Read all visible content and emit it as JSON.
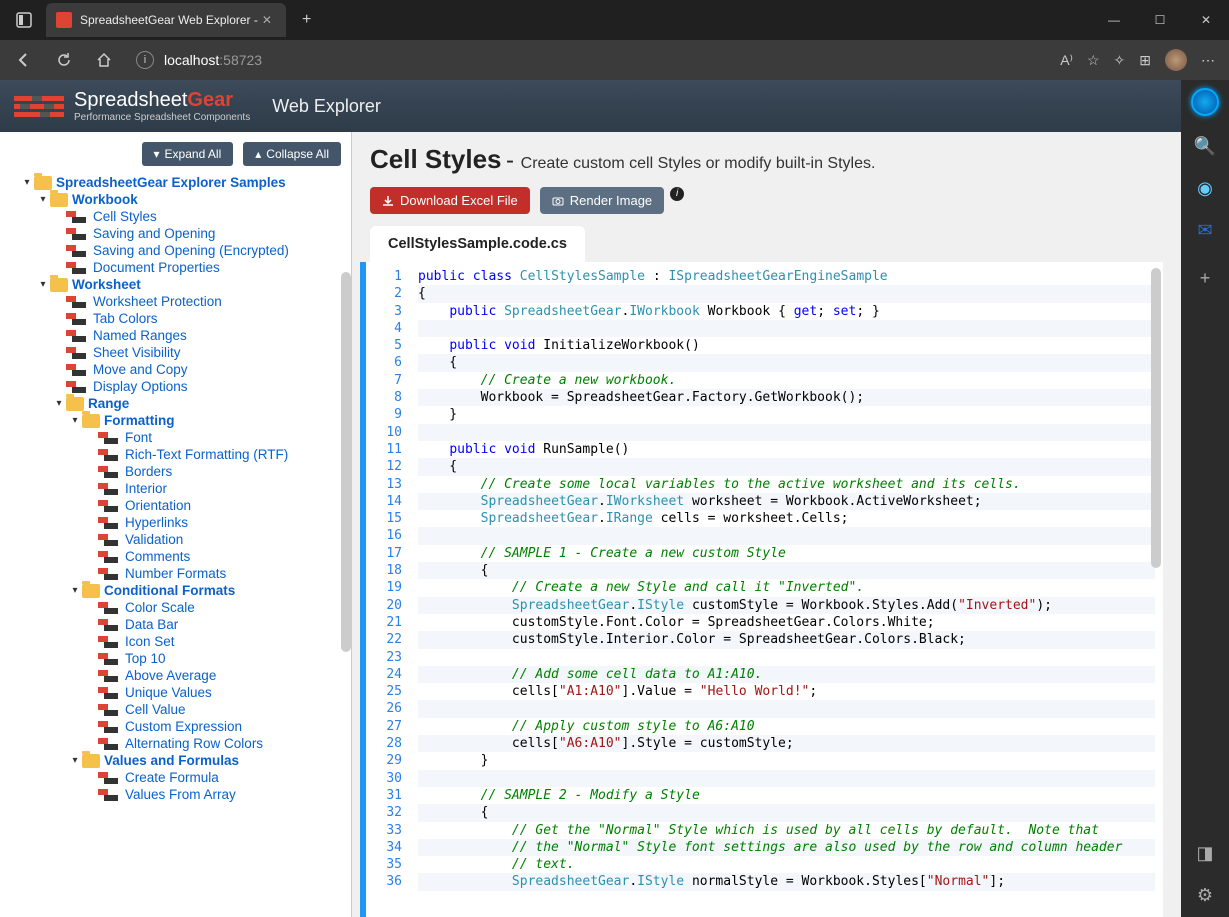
{
  "browser": {
    "tab_title": "SpreadsheetGear Web Explorer - ",
    "url_host": "localhost",
    "url_port": ":58723"
  },
  "app": {
    "brand_name_pre": "Spreadsheet",
    "brand_name_post": "Gear",
    "brand_tagline": "Performance Spreadsheet Components",
    "page_title": "Web Explorer"
  },
  "tree": {
    "expand_all": "Expand All",
    "collapse_all": "Collapse All",
    "root": "SpreadsheetGear Explorer Samples",
    "workbook": "Workbook",
    "workbook_items": [
      "Cell Styles",
      "Saving and Opening",
      "Saving and Opening (Encrypted)",
      "Document Properties"
    ],
    "worksheet": "Worksheet",
    "worksheet_items": [
      "Worksheet Protection",
      "Tab Colors",
      "Named Ranges",
      "Sheet Visibility",
      "Move and Copy",
      "Display Options"
    ],
    "range": "Range",
    "formatting": "Formatting",
    "formatting_items": [
      "Font",
      "Rich-Text Formatting (RTF)",
      "Borders",
      "Interior",
      "Orientation",
      "Hyperlinks",
      "Validation",
      "Comments",
      "Number Formats"
    ],
    "conditional": "Conditional Formats",
    "conditional_items": [
      "Color Scale",
      "Data Bar",
      "Icon Set",
      "Top 10",
      "Above Average",
      "Unique Values",
      "Cell Value",
      "Custom Expression",
      "Alternating Row Colors"
    ],
    "values": "Values and Formulas",
    "values_items": [
      "Create Formula",
      "Values From Array"
    ]
  },
  "main": {
    "title": "Cell Styles",
    "subtitle": "Create custom cell Styles or modify built-in Styles.",
    "download": "Download Excel File",
    "render": "Render Image",
    "tab": "CellStylesSample.code.cs"
  },
  "code": {
    "lines": [
      {
        "n": 1,
        "html": "<span class='kw'>public</span> <span class='kw'>class</span> <span class='tp'>CellStylesSample</span> : <span class='tp'>ISpreadsheetGearEngineSample</span>"
      },
      {
        "n": 2,
        "html": "{"
      },
      {
        "n": 3,
        "html": "    <span class='kw'>public</span> <span class='tp'>SpreadsheetGear</span>.<span class='tp'>IWorkbook</span> Workbook { <span class='kw'>get</span>; <span class='kw'>set</span>; }"
      },
      {
        "n": 4,
        "html": ""
      },
      {
        "n": 5,
        "html": "    <span class='kw'>public</span> <span class='kw'>void</span> InitializeWorkbook()"
      },
      {
        "n": 6,
        "html": "    {"
      },
      {
        "n": 7,
        "html": "        <span class='cm'>// Create a new workbook.</span>"
      },
      {
        "n": 8,
        "html": "        Workbook = SpreadsheetGear.Factory.GetWorkbook();"
      },
      {
        "n": 9,
        "html": "    }"
      },
      {
        "n": 10,
        "html": ""
      },
      {
        "n": 11,
        "html": "    <span class='kw'>public</span> <span class='kw'>void</span> RunSample()"
      },
      {
        "n": 12,
        "html": "    {"
      },
      {
        "n": 13,
        "html": "        <span class='cm'>// Create some local variables to the active worksheet and its cells.</span>"
      },
      {
        "n": 14,
        "html": "        <span class='tp'>SpreadsheetGear</span>.<span class='tp'>IWorksheet</span> worksheet = Workbook.ActiveWorksheet;"
      },
      {
        "n": 15,
        "html": "        <span class='tp'>SpreadsheetGear</span>.<span class='tp'>IRange</span> cells = worksheet.Cells;"
      },
      {
        "n": 16,
        "html": ""
      },
      {
        "n": 17,
        "html": "        <span class='cm'>// SAMPLE 1 - Create a new custom Style</span>"
      },
      {
        "n": 18,
        "html": "        {"
      },
      {
        "n": 19,
        "html": "            <span class='cm'>// Create a new Style and call it \"Inverted\".</span>"
      },
      {
        "n": 20,
        "html": "            <span class='tp'>SpreadsheetGear</span>.<span class='tp'>IStyle</span> customStyle = Workbook.Styles.Add(<span class='st'>\"Inverted\"</span>);"
      },
      {
        "n": 21,
        "html": "            customStyle.Font.Color = SpreadsheetGear.Colors.White;"
      },
      {
        "n": 22,
        "html": "            customStyle.Interior.Color = SpreadsheetGear.Colors.Black;"
      },
      {
        "n": 23,
        "html": ""
      },
      {
        "n": 24,
        "html": "            <span class='cm'>// Add some cell data to A1:A10.</span>"
      },
      {
        "n": 25,
        "html": "            cells[<span class='st'>\"A1:A10\"</span>].Value = <span class='st'>\"Hello World!\"</span>;"
      },
      {
        "n": 26,
        "html": ""
      },
      {
        "n": 27,
        "html": "            <span class='cm'>// Apply custom style to A6:A10</span>"
      },
      {
        "n": 28,
        "html": "            cells[<span class='st'>\"A6:A10\"</span>].Style = customStyle;"
      },
      {
        "n": 29,
        "html": "        }"
      },
      {
        "n": 30,
        "html": ""
      },
      {
        "n": 31,
        "html": "        <span class='cm'>// SAMPLE 2 - Modify a Style</span>"
      },
      {
        "n": 32,
        "html": "        {"
      },
      {
        "n": 33,
        "html": "            <span class='cm'>// Get the \"Normal\" Style which is used by all cells by default.  Note that</span>"
      },
      {
        "n": 34,
        "html": "            <span class='cm'>// the \"Normal\" Style font settings are also used by the row and column header</span>"
      },
      {
        "n": 35,
        "html": "            <span class='cm'>// text.</span>"
      },
      {
        "n": 36,
        "html": "            <span class='tp'>SpreadsheetGear</span>.<span class='tp'>IStyle</span> normalStyle = Workbook.Styles[<span class='st'>\"Normal\"</span>];"
      }
    ]
  }
}
